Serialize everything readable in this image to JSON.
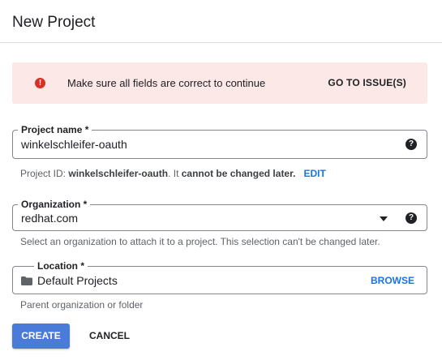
{
  "header": {
    "title": "New Project"
  },
  "alert": {
    "icon": "error-icon",
    "message": "Make sure all fields are correct to continue",
    "action_label": "GO TO ISSUE(S)",
    "color": "#d93025",
    "background": "#fce8e6"
  },
  "project_name": {
    "label": "Project name *",
    "value": "winkelschleifer-oauth",
    "help_icon": "help-icon",
    "hint_prefix": "Project ID:",
    "hint_id": "winkelschleifer-oauth",
    "hint_mid": ". It",
    "hint_bold": "cannot be changed later.",
    "edit_label": "EDIT"
  },
  "organization": {
    "label": "Organization *",
    "value": "redhat.com",
    "help_icon": "help-icon",
    "hint": "Select an organization to attach it to a project. This selection can't be changed later."
  },
  "location": {
    "label": "Location *",
    "value": "Default Projects",
    "icon": "folder-icon",
    "browse_label": "BROWSE",
    "hint": "Parent organization or folder"
  },
  "actions": {
    "create_label": "CREATE",
    "cancel_label": "CANCEL",
    "primary_color": "#4a7bd8"
  }
}
